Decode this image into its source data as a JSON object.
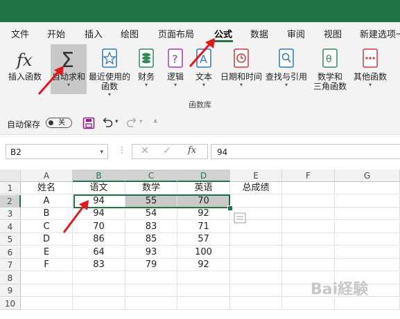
{
  "menu": {
    "items": [
      "文件",
      "开始",
      "插入",
      "绘图",
      "页面布局",
      "公式",
      "数据",
      "审阅",
      "视图",
      "新建选项一"
    ],
    "active": "公式"
  },
  "ribbon": {
    "buttons": [
      {
        "label": "插入函数",
        "icon": "fx-icon"
      },
      {
        "label": "自动求和",
        "icon": "sigma-icon"
      },
      {
        "label": "最近使用的\n函数",
        "icon": "star-book-icon"
      },
      {
        "label": "财务",
        "icon": "money-book-icon"
      },
      {
        "label": "逻辑",
        "icon": "question-book-icon"
      },
      {
        "label": "文本",
        "icon": "text-book-icon"
      },
      {
        "label": "日期和时间",
        "icon": "clock-book-icon"
      },
      {
        "label": "查找与引用",
        "icon": "search-book-icon"
      },
      {
        "label": "数学和\n三角函数",
        "icon": "theta-book-icon"
      },
      {
        "label": "其他函数",
        "icon": "dots-book-icon"
      }
    ],
    "group_label": "函数库"
  },
  "qat": {
    "autosave_label": "自动保存",
    "autosave_state": "关"
  },
  "formula_bar": {
    "name_box": "B2",
    "formula": "94"
  },
  "sheet": {
    "columns": [
      "A",
      "B",
      "C",
      "D",
      "E",
      "F",
      "G"
    ],
    "rows": [
      "1",
      "2",
      "3",
      "4",
      "5",
      "6",
      "7",
      "8",
      "9",
      "10"
    ],
    "cells": [
      [
        "姓名",
        "语文",
        "数学",
        "英语",
        "总成绩",
        "",
        ""
      ],
      [
        "A",
        "94",
        "55",
        "70",
        "",
        "",
        ""
      ],
      [
        "B",
        "94",
        "54",
        "92",
        "",
        "",
        ""
      ],
      [
        "C",
        "70",
        "83",
        "71",
        "",
        "",
        ""
      ],
      [
        "D",
        "86",
        "85",
        "57",
        "",
        "",
        ""
      ],
      [
        "E",
        "64",
        "93",
        "100",
        "",
        "",
        ""
      ],
      [
        "F",
        "83",
        "79",
        "92",
        "",
        "",
        ""
      ],
      [
        "",
        "",
        "",
        "",
        "",
        "",
        ""
      ],
      [
        "",
        "",
        "",
        "",
        "",
        "",
        ""
      ],
      [
        "",
        "",
        "",
        "",
        "",
        "",
        ""
      ]
    ],
    "active_cell": "B2",
    "selected_range": "B2:D2"
  },
  "colors": {
    "title_bar": "#217346",
    "accent": "#217346",
    "annotation_arrow": "#e8141b"
  }
}
